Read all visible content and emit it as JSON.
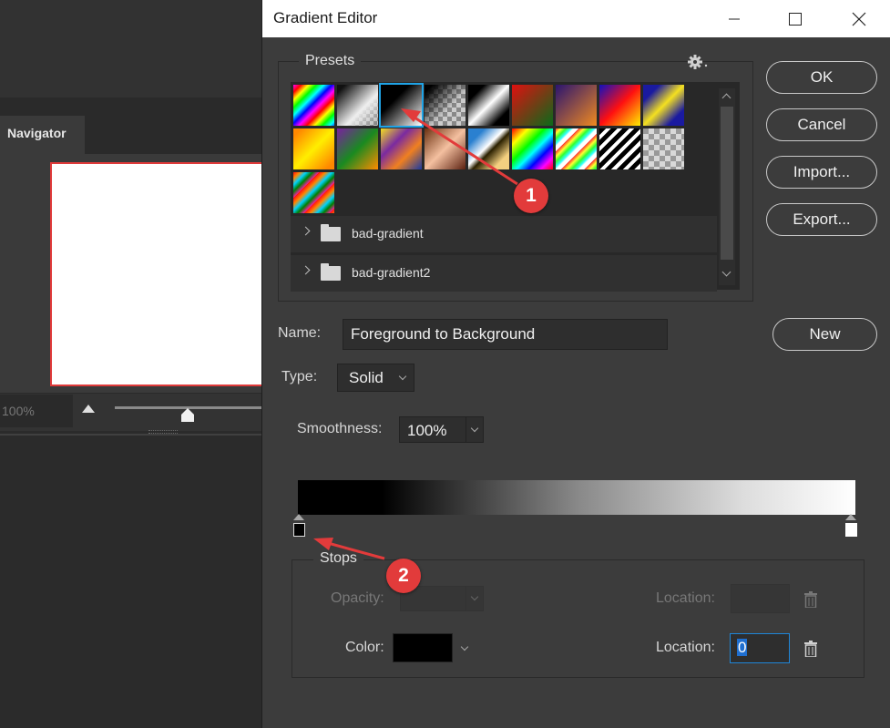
{
  "workspace": {
    "navigator_tab": "Navigator",
    "zoom_value": "100%"
  },
  "dialog": {
    "title": "Gradient Editor",
    "presets": {
      "label": "Presets",
      "swatches": [
        {
          "name": "spectrum-diagonal",
          "selected": false
        },
        {
          "name": "transparent-rainbow",
          "selected": false
        },
        {
          "name": "black-white",
          "selected": true
        },
        {
          "name": "black-transparent",
          "selected": false
        },
        {
          "name": "black-white-black",
          "selected": false
        },
        {
          "name": "red-green",
          "selected": false
        },
        {
          "name": "violet-orange",
          "selected": false
        },
        {
          "name": "blue-red-yellow",
          "selected": false
        },
        {
          "name": "blue-yellow-blue",
          "selected": false
        },
        {
          "name": "orange-yellow-orange",
          "selected": false
        },
        {
          "name": "violet-green-orange",
          "selected": false
        },
        {
          "name": "yellow-violet-orange-blue",
          "selected": false
        },
        {
          "name": "copper",
          "selected": false
        },
        {
          "name": "chrome",
          "selected": false
        },
        {
          "name": "spectrum",
          "selected": false
        },
        {
          "name": "transparent-rainbow-stripes",
          "selected": false
        },
        {
          "name": "transparent-stripes",
          "selected": false
        },
        {
          "name": "transparent-checker",
          "selected": false
        },
        {
          "name": "teal-green-orange-diagonal",
          "selected": false
        }
      ],
      "groups": [
        "bad-gradient",
        "bad-gradient2"
      ]
    },
    "buttons": {
      "ok": "OK",
      "cancel": "Cancel",
      "import": "Import...",
      "export": "Export...",
      "new": "New"
    },
    "name_label": "Name:",
    "name_value": "Foreground to Background",
    "type_label": "Type:",
    "type_value": "Solid",
    "smoothness_label": "Smoothness:",
    "smoothness_value": "100%",
    "stops": {
      "label": "Stops",
      "opacity_label": "Opacity:",
      "opacity_location_label": "Location:",
      "color_label": "Color:",
      "color_location_label": "Location:",
      "color_location_value": "0",
      "color_value": "#000000"
    }
  },
  "annotations": {
    "badge1": "1",
    "badge2": "2",
    "accent": "#e23b3b"
  }
}
